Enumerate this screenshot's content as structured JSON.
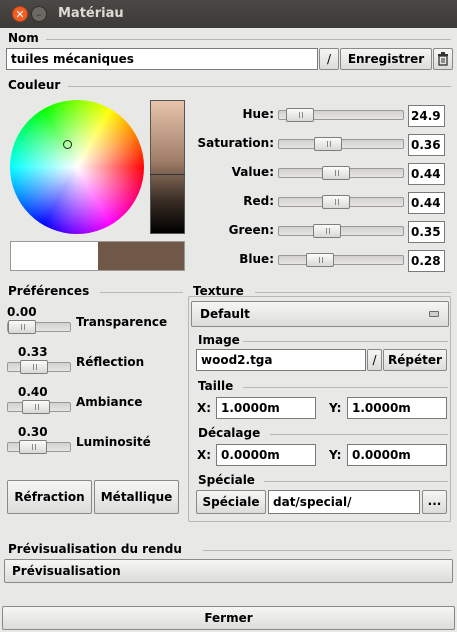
{
  "window": {
    "title": "Matériau"
  },
  "nom": {
    "section": "Nom",
    "value": "tuiles mécaniques",
    "slash_label": "/",
    "save_label": "Enregistrer",
    "delete_icon": "trash-icon"
  },
  "couleur": {
    "section": "Couleur",
    "preview_old": "#ffffff",
    "preview_new": "#705848",
    "sliders": [
      {
        "label": "Hue:",
        "value": "24.9",
        "fraction": 0.07
      },
      {
        "label": "Saturation:",
        "value": "0.36",
        "fraction": 0.36
      },
      {
        "label": "Value:",
        "value": "0.44",
        "fraction": 0.44
      },
      {
        "label": "Red:",
        "value": "0.44",
        "fraction": 0.44
      },
      {
        "label": "Green:",
        "value": "0.35",
        "fraction": 0.35
      },
      {
        "label": "Blue:",
        "value": "0.28",
        "fraction": 0.28
      }
    ]
  },
  "preferences": {
    "section": "Préférences",
    "items": [
      {
        "label": "Transparence",
        "value": "0.00",
        "fraction": 0.0
      },
      {
        "label": "Réflection",
        "value": "0.33",
        "fraction": 0.33
      },
      {
        "label": "Ambiance",
        "value": "0.40",
        "fraction": 0.4
      },
      {
        "label": "Luminosité",
        "value": "0.30",
        "fraction": 0.3
      }
    ],
    "refraction_label": "Réfraction",
    "metallique_label": "Métallique"
  },
  "texture": {
    "section": "Texture",
    "dropdown_value": "Default",
    "image": {
      "section": "Image",
      "value": "wood2.tga",
      "slash_label": "/",
      "repeat_label": "Répéter"
    },
    "taille": {
      "section": "Taille",
      "x_label": "X:",
      "x_value": "1.0000m",
      "y_label": "Y:",
      "y_value": "1.0000m"
    },
    "decalage": {
      "section": "Décalage",
      "x_label": "X:",
      "x_value": "0.0000m",
      "y_label": "Y:",
      "y_value": "0.0000m"
    },
    "speciale": {
      "section": "Spéciale",
      "button_label": "Spéciale",
      "value": "dat/special/",
      "browse_label": "..."
    }
  },
  "preview": {
    "section": "Prévisualisation du rendu",
    "button_label": "Prévisualisation"
  },
  "footer": {
    "close_label": "Fermer"
  }
}
